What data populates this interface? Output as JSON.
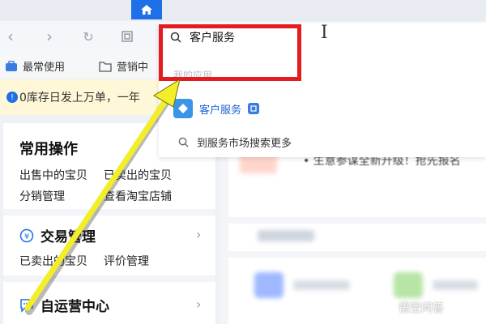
{
  "browser": {
    "search_query": "客户服务"
  },
  "bookmarks": [
    {
      "label": "最常使用",
      "icon": "briefcase-icon"
    },
    {
      "label": "营销中",
      "icon": "folder-icon"
    }
  ],
  "notice": {
    "text": "0库存日发上万单，一年"
  },
  "left_panel": {
    "common_ops": {
      "title": "常用操作",
      "links": [
        "出售中的宝贝",
        "已卖出的宝贝",
        "分销管理",
        "查看淘宝店铺"
      ]
    },
    "trade": {
      "title": "交易管理",
      "links": [
        "已卖出的宝贝",
        "评价管理"
      ]
    },
    "self_ops": {
      "title": "自运营中心"
    }
  },
  "dropdown": {
    "section_label": "我的应用",
    "result_label": "客户服务",
    "more_label": "到服务市场搜索更多"
  },
  "main": {
    "news_text": "生意参谋全新升级！抢先报名"
  },
  "watermark": {
    "text": "悟空问答"
  },
  "colors": {
    "accent": "#1e6fe8",
    "highlight_box": "#e41b1f",
    "arrow": "#f2ee27"
  }
}
